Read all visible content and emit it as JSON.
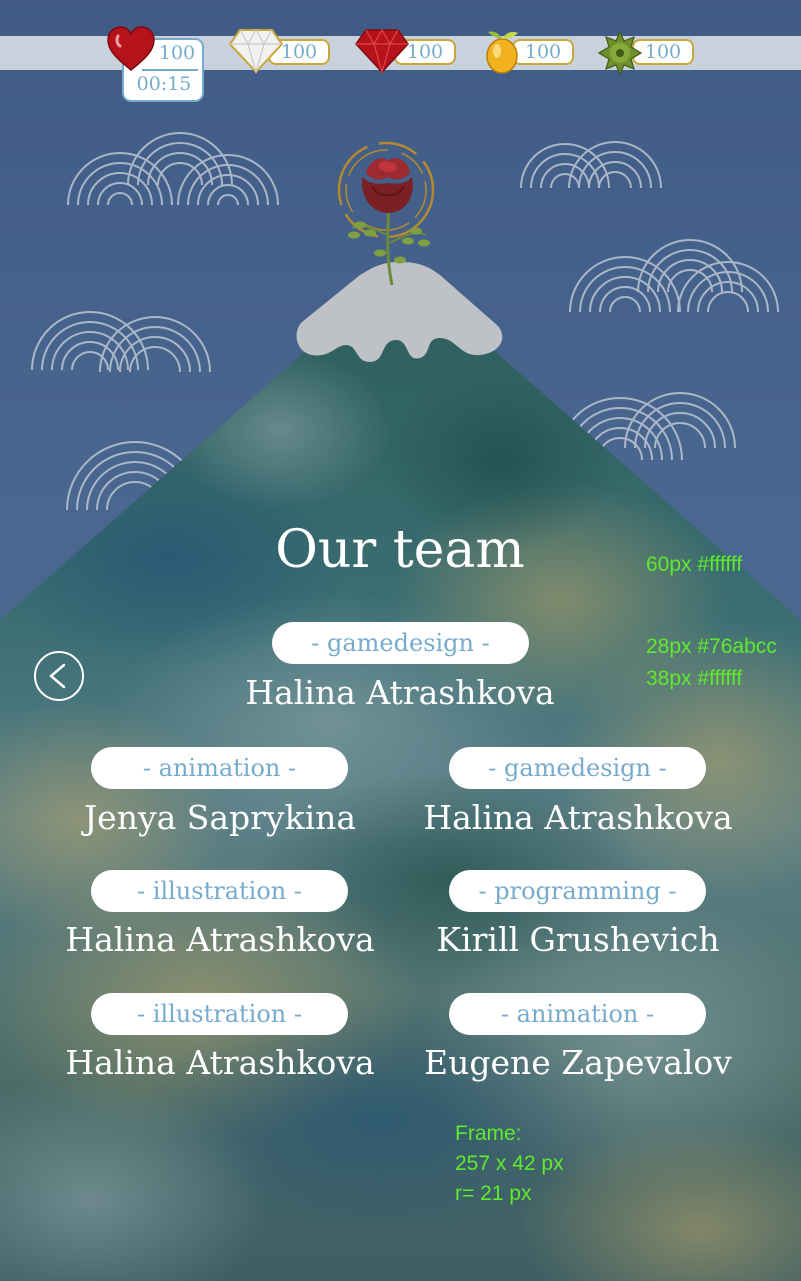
{
  "resources": {
    "lives": {
      "value": "100",
      "timer": "00:15",
      "icon": "heart-icon"
    },
    "diamonds": {
      "value": "100",
      "icon": "diamond-icon"
    },
    "rubies": {
      "value": "100",
      "icon": "ruby-icon"
    },
    "fruit": {
      "value": "100",
      "icon": "fruit-icon"
    },
    "spikes": {
      "value": "100",
      "icon": "spiky-ball-icon"
    }
  },
  "title": "Our team",
  "back_icon": "back-arrow-icon",
  "credits": [
    {
      "role": "- gamedesign -",
      "name": "Halina Atrashkova"
    },
    {
      "role": "- animation -",
      "name": "Jenya Saprykina"
    },
    {
      "role": "- gamedesign -",
      "name": "Halina Atrashkova"
    },
    {
      "role": "- illustration -",
      "name": "Halina Atrashkova"
    },
    {
      "role": "- programming -",
      "name": "Kirill Grushevich"
    },
    {
      "role": "- illustration -",
      "name": "Halina Atrashkova"
    },
    {
      "role": "- animation -",
      "name": "Eugene Zapevalov"
    }
  ],
  "spec_notes": {
    "title_spec": "60px #ffffff",
    "role_spec": "28px #76abcc",
    "name_spec": "38px #ffffff",
    "frame_label": "Frame:",
    "frame_size": "257 x 42 px",
    "frame_radius": "r= 21 px"
  },
  "colors": {
    "sky": "#415d88",
    "role_text": "#76abcc",
    "name_text": "#ffffff",
    "spec_text": "#5fea2d",
    "mountain": "#2f5a5c",
    "snow": "#bfc3c7"
  }
}
